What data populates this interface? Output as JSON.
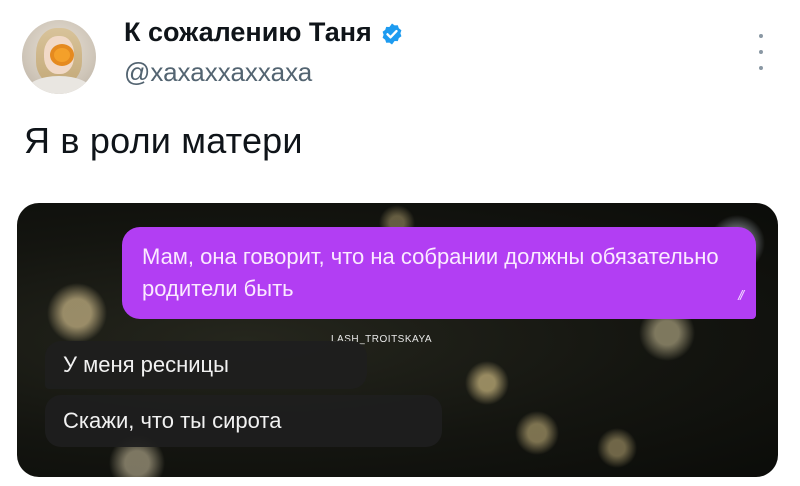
{
  "tweet": {
    "author": {
      "display_name": "К сожалению Таня",
      "handle": "@хахаххаххаха",
      "verified": true
    },
    "text": "Я в роли матери",
    "media": {
      "watermark": "LASH_TROITSKAYA",
      "messages": [
        {
          "direction": "outgoing",
          "text": "Мам, она говорит, что на собрании должны обязательно родители быть",
          "status": "//"
        },
        {
          "direction": "incoming",
          "text": "У меня ресницы"
        },
        {
          "direction": "incoming",
          "text": "Скажи, что ты сирота"
        }
      ]
    }
  },
  "colors": {
    "verified_badge": "#1d9bf0",
    "outgoing_bubble": "#b23ef3",
    "incoming_bubble": "#1e1e1e"
  },
  "icons": {
    "verified": "verified-badge-icon",
    "more": "more-options-icon"
  }
}
